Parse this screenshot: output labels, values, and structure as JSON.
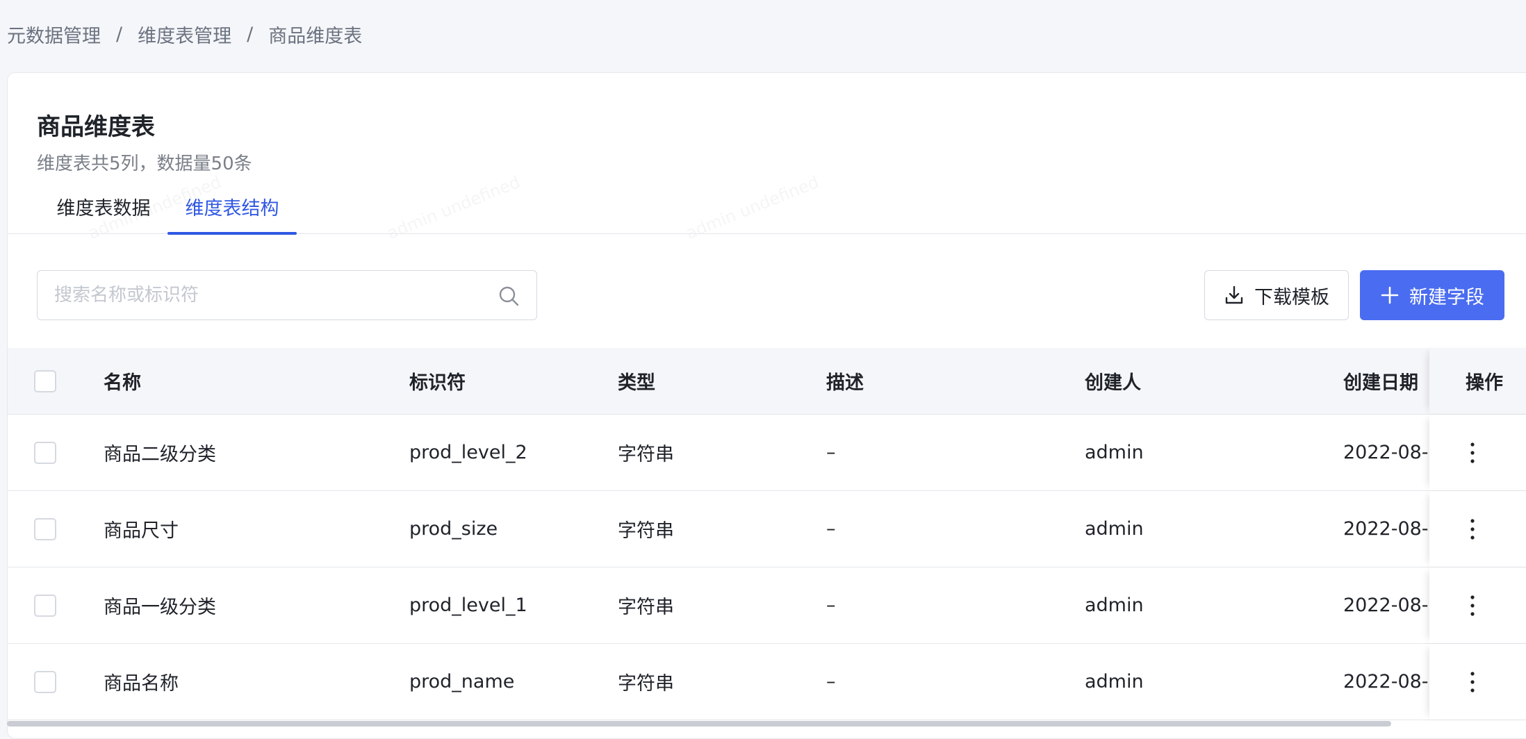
{
  "breadcrumb": {
    "items": [
      "元数据管理",
      "维度表管理",
      "商品维度表"
    ],
    "separator": "/"
  },
  "header": {
    "title": "商品维度表",
    "subtitle": "维度表共5列，数据量50条"
  },
  "tabs": [
    {
      "label": "维度表数据",
      "active": false
    },
    {
      "label": "维度表结构",
      "active": true
    }
  ],
  "toolbar": {
    "search_placeholder": "搜索名称或标识符",
    "search_value": "",
    "download_label": "下载模板",
    "new_field_label": "新建字段"
  },
  "table": {
    "columns": [
      "名称",
      "标识符",
      "类型",
      "描述",
      "创建人",
      "创建日期",
      "操作"
    ],
    "rows": [
      {
        "name": "商品二级分类",
        "id": "prod_level_2",
        "type": "字符串",
        "desc": "–",
        "creator": "admin",
        "date": "2022-08-"
      },
      {
        "name": "商品尺寸",
        "id": "prod_size",
        "type": "字符串",
        "desc": "–",
        "creator": "admin",
        "date": "2022-08-"
      },
      {
        "name": "商品一级分类",
        "id": "prod_level_1",
        "type": "字符串",
        "desc": "–",
        "creator": "admin",
        "date": "2022-08-"
      },
      {
        "name": "商品名称",
        "id": "prod_name",
        "type": "字符串",
        "desc": "–",
        "creator": "admin",
        "date": "2022-08-"
      }
    ]
  },
  "watermark": {
    "text": "admin undefined"
  },
  "colors": {
    "accent": "#3058e3",
    "primary_button": "#4a6cf0",
    "page_bg": "#f5f6f9"
  },
  "icons": {
    "search": "search-icon",
    "download": "download-icon",
    "plus": "plus-icon",
    "more": "more-vertical-icon"
  }
}
